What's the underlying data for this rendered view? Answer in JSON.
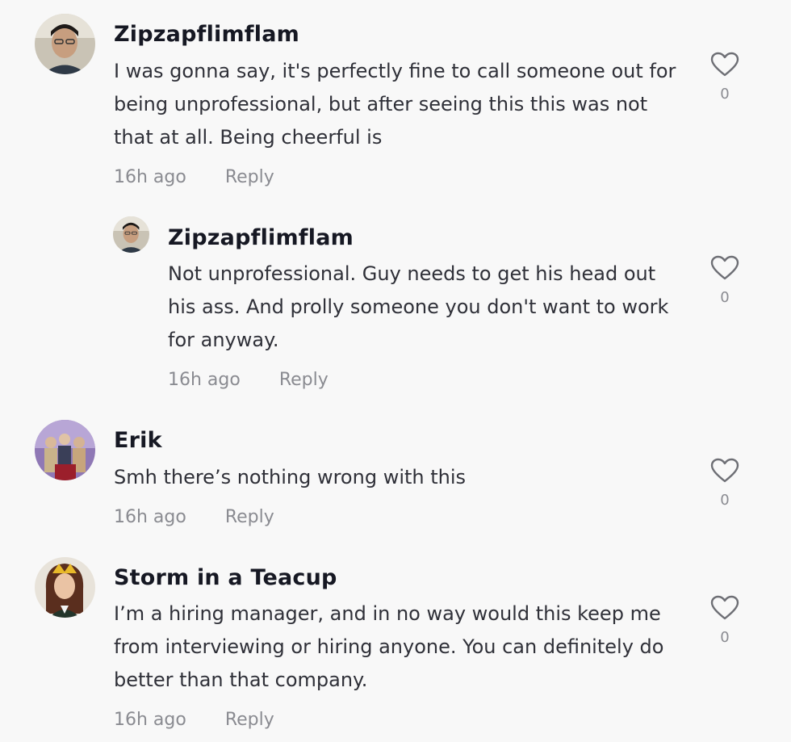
{
  "comments": [
    {
      "username": "Zipzapflimflam",
      "text": "I was gonna say, it's perfectly fine to call someone out for being unprofessional, but after seeing this this was not that at all. Being cheerful is",
      "time": "16h ago",
      "reply_label": "Reply",
      "likes": "0",
      "avatar_icon": "man-portrait-avatar",
      "replies": [
        {
          "username": "Zipzapflimflam",
          "text": "Not unprofessional. Guy needs to get his head out his ass. And prolly someone you don't want to work for anyway.",
          "time": "16h ago",
          "reply_label": "Reply",
          "likes": "0",
          "avatar_icon": "man-portrait-avatar"
        }
      ]
    },
    {
      "username": "Erik",
      "text": "Smh there’s nothing wrong with this",
      "time": "16h ago",
      "reply_label": "Reply",
      "likes": "0",
      "avatar_icon": "group-photo-avatar"
    },
    {
      "username": "Storm in a Teacup",
      "text": "I’m a hiring manager, and in no way would this keep me from interviewing or hiring anyone. You can definitely do better than that company.",
      "time": "16h ago",
      "reply_label": "Reply",
      "likes": "0",
      "avatar_icon": "woman-portrait-avatar"
    }
  ],
  "colors": {
    "background": "#f8f8f8",
    "username": "#161823",
    "text": "#2f3038",
    "meta": "#8a8b91"
  }
}
